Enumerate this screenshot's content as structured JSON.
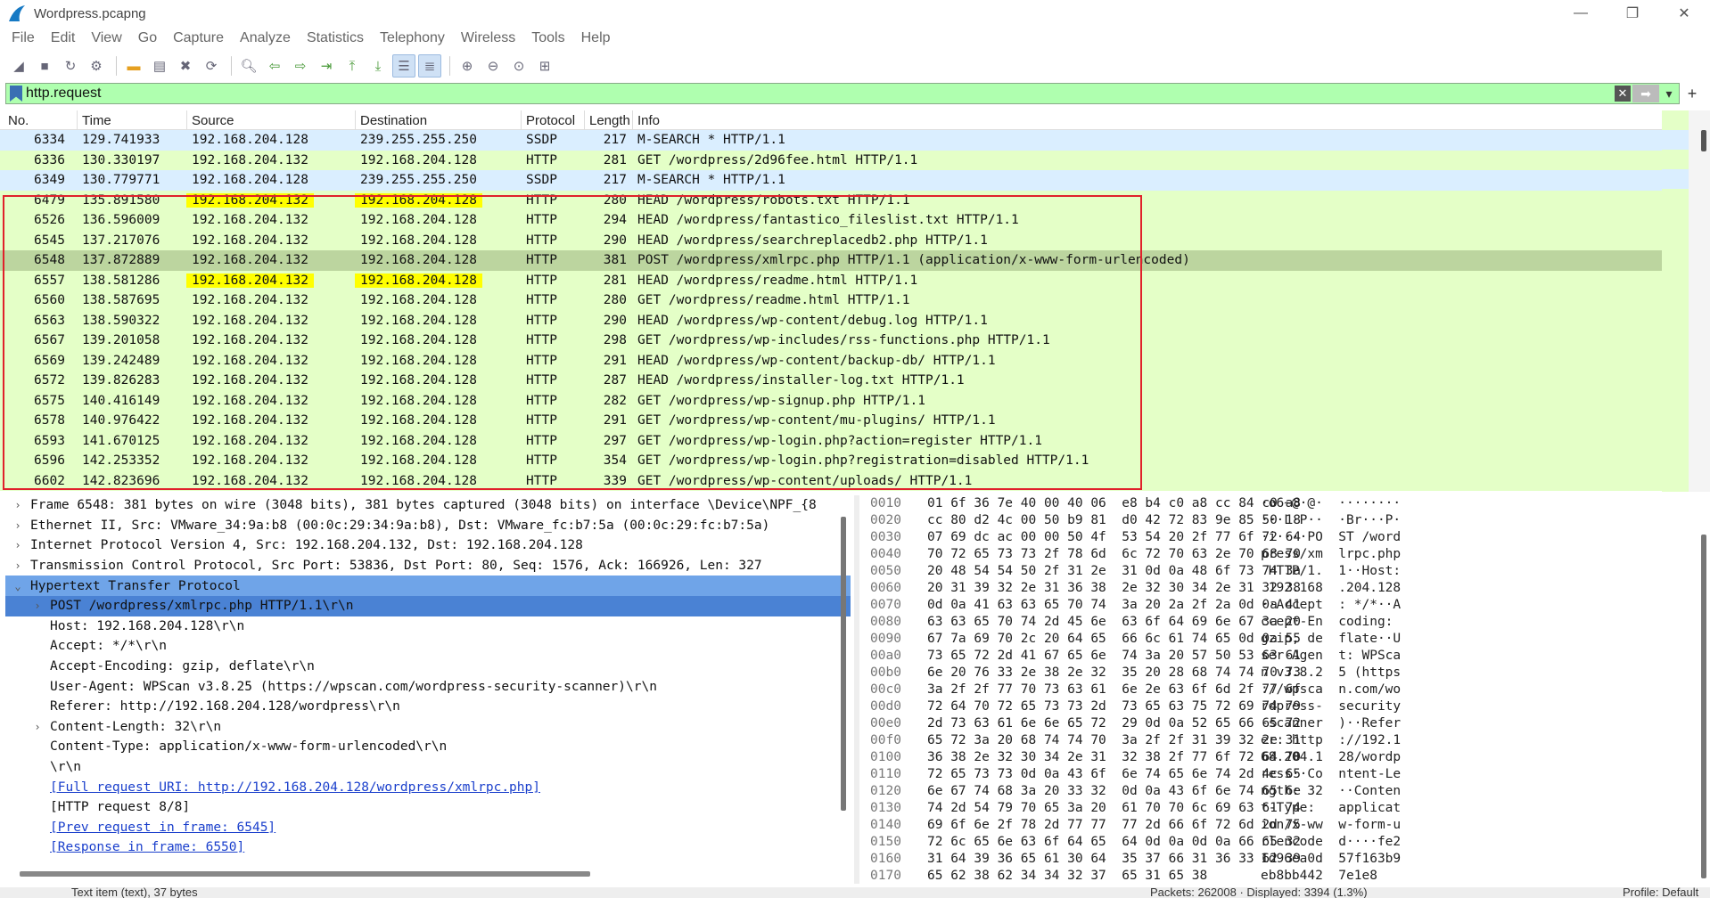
{
  "window": {
    "title": "Wordpress.pcapng",
    "minimize": "—",
    "maximize": "❐",
    "close": "✕"
  },
  "menu": [
    "File",
    "Edit",
    "View",
    "Go",
    "Capture",
    "Analyze",
    "Statistics",
    "Telephony",
    "Wireless",
    "Tools",
    "Help"
  ],
  "filter": {
    "value": "http.request",
    "add": "+"
  },
  "columns": {
    "no": "No.",
    "time": "Time",
    "source": "Source",
    "destination": "Destination",
    "protocol": "Protocol",
    "length": "Length",
    "info": "Info"
  },
  "packets": [
    {
      "no": "6334",
      "time": "129.741933",
      "src": "192.168.204.128",
      "dst": "239.255.255.250",
      "proto": "SSDP",
      "len": "217",
      "info": "M-SEARCH * HTTP/1.1",
      "kind": "ssdp"
    },
    {
      "no": "6336",
      "time": "130.330197",
      "src": "192.168.204.132",
      "dst": "192.168.204.128",
      "proto": "HTTP",
      "len": "281",
      "info": "GET /wordpress/2d96fee.html HTTP/1.1",
      "kind": "http"
    },
    {
      "no": "6349",
      "time": "130.779771",
      "src": "192.168.204.128",
      "dst": "239.255.255.250",
      "proto": "SSDP",
      "len": "217",
      "info": "M-SEARCH * HTTP/1.1",
      "kind": "ssdp"
    },
    {
      "no": "6479",
      "time": "135.891580",
      "src": "192.168.204.132",
      "dst": "192.168.204.128",
      "proto": "HTTP",
      "len": "280",
      "info": "HEAD /wordpress/robots.txt HTTP/1.1",
      "kind": "http",
      "highlight": true
    },
    {
      "no": "6526",
      "time": "136.596009",
      "src": "192.168.204.132",
      "dst": "192.168.204.128",
      "proto": "HTTP",
      "len": "294",
      "info": "HEAD /wordpress/fantastico_fileslist.txt HTTP/1.1",
      "kind": "http"
    },
    {
      "no": "6545",
      "time": "137.217076",
      "src": "192.168.204.132",
      "dst": "192.168.204.128",
      "proto": "HTTP",
      "len": "290",
      "info": "HEAD /wordpress/searchreplacedb2.php HTTP/1.1",
      "kind": "http"
    },
    {
      "no": "6548",
      "time": "137.872889",
      "src": "192.168.204.132",
      "dst": "192.168.204.128",
      "proto": "HTTP",
      "len": "381",
      "info": "POST /wordpress/xmlrpc.php HTTP/1.1  (application/x-www-form-urlencoded)",
      "kind": "sel"
    },
    {
      "no": "6557",
      "time": "138.581286",
      "src": "192.168.204.132",
      "dst": "192.168.204.128",
      "proto": "HTTP",
      "len": "281",
      "info": "HEAD /wordpress/readme.html HTTP/1.1",
      "kind": "http",
      "highlight": true
    },
    {
      "no": "6560",
      "time": "138.587695",
      "src": "192.168.204.132",
      "dst": "192.168.204.128",
      "proto": "HTTP",
      "len": "280",
      "info": "GET /wordpress/readme.html HTTP/1.1",
      "kind": "http"
    },
    {
      "no": "6563",
      "time": "138.590322",
      "src": "192.168.204.132",
      "dst": "192.168.204.128",
      "proto": "HTTP",
      "len": "290",
      "info": "HEAD /wordpress/wp-content/debug.log HTTP/1.1",
      "kind": "http"
    },
    {
      "no": "6567",
      "time": "139.201058",
      "src": "192.168.204.132",
      "dst": "192.168.204.128",
      "proto": "HTTP",
      "len": "298",
      "info": "GET /wordpress/wp-includes/rss-functions.php HTTP/1.1",
      "kind": "http"
    },
    {
      "no": "6569",
      "time": "139.242489",
      "src": "192.168.204.132",
      "dst": "192.168.204.128",
      "proto": "HTTP",
      "len": "291",
      "info": "HEAD /wordpress/wp-content/backup-db/ HTTP/1.1",
      "kind": "http"
    },
    {
      "no": "6572",
      "time": "139.826283",
      "src": "192.168.204.132",
      "dst": "192.168.204.128",
      "proto": "HTTP",
      "len": "287",
      "info": "HEAD /wordpress/installer-log.txt HTTP/1.1",
      "kind": "http"
    },
    {
      "no": "6575",
      "time": "140.416149",
      "src": "192.168.204.132",
      "dst": "192.168.204.128",
      "proto": "HTTP",
      "len": "282",
      "info": "GET /wordpress/wp-signup.php HTTP/1.1",
      "kind": "http"
    },
    {
      "no": "6578",
      "time": "140.976422",
      "src": "192.168.204.132",
      "dst": "192.168.204.128",
      "proto": "HTTP",
      "len": "291",
      "info": "GET /wordpress/wp-content/mu-plugins/ HTTP/1.1",
      "kind": "http"
    },
    {
      "no": "6593",
      "time": "141.670125",
      "src": "192.168.204.132",
      "dst": "192.168.204.128",
      "proto": "HTTP",
      "len": "297",
      "info": "GET /wordpress/wp-login.php?action=register HTTP/1.1",
      "kind": "http"
    },
    {
      "no": "6596",
      "time": "142.253352",
      "src": "192.168.204.132",
      "dst": "192.168.204.128",
      "proto": "HTTP",
      "len": "354",
      "info": "GET /wordpress/wp-login.php?registration=disabled HTTP/1.1",
      "kind": "http"
    },
    {
      "no": "6602",
      "time": "142.823696",
      "src": "192.168.204.132",
      "dst": "192.168.204.128",
      "proto": "HTTP",
      "len": "339",
      "info": "GET /wordpress/wp-content/uploads/ HTTP/1.1",
      "kind": "http"
    }
  ],
  "details": [
    {
      "text": "Frame 6548: 381 bytes on wire (3048 bits), 381 bytes captured (3048 bits) on interface \\Device\\NPF_{8",
      "exp": "›",
      "level": 0
    },
    {
      "text": "Ethernet II, Src: VMware_34:9a:b8 (00:0c:29:34:9a:b8), Dst: VMware_fc:b7:5a (00:0c:29:fc:b7:5a)",
      "exp": "›",
      "level": 0
    },
    {
      "text": "Internet Protocol Version 4, Src: 192.168.204.132, Dst: 192.168.204.128",
      "exp": "›",
      "level": 0
    },
    {
      "text": "Transmission Control Protocol, Src Port: 53836, Dst Port: 80, Seq: 1576, Ack: 166926, Len: 327",
      "exp": "›",
      "level": 0
    },
    {
      "text": "Hypertext Transfer Protocol",
      "exp": "⌄",
      "level": 0,
      "state": "sel"
    },
    {
      "text": "POST /wordpress/xmlrpc.php HTTP/1.1\\r\\n",
      "exp": "›",
      "level": 1,
      "state": "sel2"
    },
    {
      "text": "Host: 192.168.204.128\\r\\n",
      "exp": "",
      "level": 1
    },
    {
      "text": "Accept: */*\\r\\n",
      "exp": "",
      "level": 1
    },
    {
      "text": "Accept-Encoding: gzip, deflate\\r\\n",
      "exp": "",
      "level": 1
    },
    {
      "text": "User-Agent: WPScan v3.8.25 (https://wpscan.com/wordpress-security-scanner)\\r\\n",
      "exp": "",
      "level": 1
    },
    {
      "text": "Referer: http://192.168.204.128/wordpress\\r\\n",
      "exp": "",
      "level": 1
    },
    {
      "text": "Content-Length: 32\\r\\n",
      "exp": "›",
      "level": 1
    },
    {
      "text": "Content-Type: application/x-www-form-urlencoded\\r\\n",
      "exp": "",
      "level": 1
    },
    {
      "text": "\\r\\n",
      "exp": "",
      "level": 1
    },
    {
      "text": "[Full request URI: http://192.168.204.128/wordpress/xmlrpc.php]",
      "exp": "",
      "level": 1,
      "link": true
    },
    {
      "text": "[HTTP request 8/8]",
      "exp": "",
      "level": 1
    },
    {
      "text": "[Prev request in frame: 6545]",
      "exp": "",
      "level": 1,
      "link": true
    },
    {
      "text": "[Response in frame: 6550]",
      "exp": "",
      "level": 1,
      "link": true
    }
  ],
  "hex": [
    {
      "off": "0010",
      "bytes": "01 6f 36 7e 40 00 40 06  e8 b4 c0 a8 cc 84 c0 a8",
      "ascii": "·o6~@·@·  ········"
    },
    {
      "off": "0020",
      "bytes": "cc 80 d2 4c 00 50 b9 81  d0 42 72 83 9e 85 50 18",
      "ascii": "···L·P··  ·Br···P·"
    },
    {
      "off": "0030",
      "bytes": "07 69 dc ac 00 00 50 4f  53 54 20 2f 77 6f 72 64",
      "ascii": "·i····PO  ST /word"
    },
    {
      "off": "0040",
      "bytes": "70 72 65 73 73 2f 78 6d  6c 72 70 63 2e 70 68 70",
      "ascii": "press/xm  lrpc.php"
    },
    {
      "off": "0050",
      "bytes": "20 48 54 54 50 2f 31 2e  31 0d 0a 48 6f 73 74 3a",
      "ascii": " HTTP/1.  1··Host:"
    },
    {
      "off": "0060",
      "bytes": "20 31 39 32 2e 31 36 38  2e 32 30 34 2e 31 32 38",
      "ascii": " 192.168  .204.128"
    },
    {
      "off": "0070",
      "bytes": "0d 0a 41 63 63 65 70 74  3a 20 2a 2f 2a 0d 0a 41",
      "ascii": "··Accept  : */*··A"
    },
    {
      "off": "0080",
      "bytes": "63 63 65 70 74 2d 45 6e  63 6f 64 69 6e 67 3a 20",
      "ascii": "ccept-En  coding: "
    },
    {
      "off": "0090",
      "bytes": "67 7a 69 70 2c 20 64 65  66 6c 61 74 65 0d 0a 55",
      "ascii": "gzip, de  flate··U"
    },
    {
      "off": "00a0",
      "bytes": "73 65 72 2d 41 67 65 6e  74 3a 20 57 50 53 63 61",
      "ascii": "ser-Agen  t: WPSca"
    },
    {
      "off": "00b0",
      "bytes": "6e 20 76 33 2e 38 2e 32  35 20 28 68 74 74 70 73",
      "ascii": "n v3.8.2  5 (https"
    },
    {
      "off": "00c0",
      "bytes": "3a 2f 2f 77 70 73 63 61  6e 2e 63 6f 6d 2f 77 6f",
      "ascii": "://wpsca  n.com/wo"
    },
    {
      "off": "00d0",
      "bytes": "72 64 70 72 65 73 73 2d  73 65 63 75 72 69 74 79",
      "ascii": "rdpress-  security"
    },
    {
      "off": "00e0",
      "bytes": "2d 73 63 61 6e 6e 65 72  29 0d 0a 52 65 66 65 72",
      "ascii": "-scanner  )··Refer"
    },
    {
      "off": "00f0",
      "bytes": "65 72 3a 20 68 74 74 70  3a 2f 2f 31 39 32 2e 31",
      "ascii": "er: http  ://192.1"
    },
    {
      "off": "0100",
      "bytes": "36 38 2e 32 30 34 2e 31  32 38 2f 77 6f 72 64 70",
      "ascii": "68.204.1  28/wordp"
    },
    {
      "off": "0110",
      "bytes": "72 65 73 73 0d 0a 43 6f  6e 74 65 6e 74 2d 4c 65",
      "ascii": "ress··Co  ntent-Le"
    },
    {
      "off": "0120",
      "bytes": "6e 67 74 68 3a 20 33 32  0d 0a 43 6f 6e 74 65 6e",
      "ascii": "ngth: 32  ··Conten"
    },
    {
      "off": "0130",
      "bytes": "74 2d 54 79 70 65 3a 20  61 70 70 6c 69 63 61 74",
      "ascii": "t-Type:   applicat"
    },
    {
      "off": "0140",
      "bytes": "69 6f 6e 2f 78 2d 77 77  77 2d 66 6f 72 6d 2d 75",
      "ascii": "ion/x-ww  w-form-u"
    },
    {
      "off": "0150",
      "bytes": "72 6c 65 6e 63 6f 64 65  64 0d 0a 0d 0a 66 65 32",
      "ascii": "rlencode  d····fe2"
    },
    {
      "off": "0160",
      "bytes": "31 64 39 36 65 61 30 64  35 37 66 31 36 33 62 39",
      "ascii": "1d96ea0d  57f163b9"
    },
    {
      "off": "0170",
      "bytes": "65 62 38 62 34 34 32 37  65 31 65 38",
      "ascii": "eb8bb442  7e1e8"
    }
  ],
  "status": {
    "text_item": "Text item (text), 37 bytes",
    "packets": "Packets: 262008 · Displayed: 3394 (1.3%)",
    "profile": "Profile: Default"
  },
  "colors": {
    "http_row": "#e4ffc7",
    "ssdp_row": "#daeeff",
    "selected_row": "#bcd59f",
    "highlight": "#ffff00",
    "annotation_box": "#e0212b",
    "filter_bg": "#afffaf",
    "tree_selected": "#6fa4e8"
  }
}
